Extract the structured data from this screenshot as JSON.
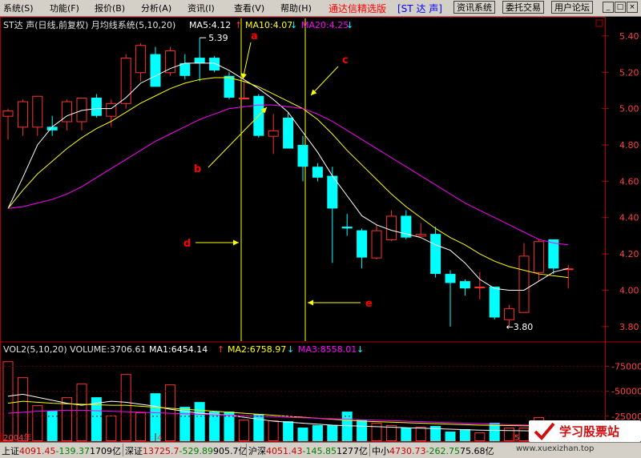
{
  "menu": {
    "items": [
      "系统(S)",
      "功能(F)",
      "报价(B)",
      "分析(A)",
      "资讯(I)",
      "查看(V)",
      "帮助(H)"
    ],
    "brand": "通达信精选版",
    "stock_tag": "[ST 达  声]",
    "buttons": [
      "资讯系统",
      "委托交易",
      "用户论坛"
    ],
    "window_controls": [
      "_",
      "□",
      "×"
    ]
  },
  "header": {
    "title": "ST达 声(日线,前复权) 月均线系统(5,10,20)",
    "ma5": "MA5:4.12",
    "ma10": "MA10:4.07",
    "ma20": "MA20:4.25"
  },
  "volume_header": {
    "title": "VOL2(5,10,20) VOLUME:3706.61",
    "ma1": "MA1:6454.14",
    "ma2": "MA2:6758.97",
    "ma3": "MA3:8558.01"
  },
  "annotations": {
    "a": "a",
    "b": "b",
    "c": "c",
    "d": "d",
    "e": "e",
    "high_label": "5.39",
    "low_label": "3.80"
  },
  "chart_data": {
    "type": "candlestick",
    "ylim": [
      3.72,
      5.47
    ],
    "yticks": [
      "5.40",
      "5.20",
      "5.00",
      "4.80",
      "4.60",
      "4.40",
      "4.20",
      "4.00",
      "3.80"
    ],
    "x_labels": [
      "2004年",
      "4",
      "5"
    ],
    "candles": [
      {
        "o": 4.96,
        "h": 5.0,
        "l": 4.83,
        "c": 4.99,
        "v": 10000
      },
      {
        "o": 4.9,
        "h": 5.05,
        "l": 4.85,
        "c": 5.04,
        "v": 8000
      },
      {
        "o": 4.9,
        "h": 5.07,
        "l": 4.85,
        "c": 5.07,
        "v": 4500
      },
      {
        "o": 4.9,
        "h": 4.96,
        "l": 4.85,
        "c": 4.88,
        "v": 3800
      },
      {
        "o": 4.93,
        "h": 5.05,
        "l": 4.88,
        "c": 5.04,
        "v": 5500
      },
      {
        "o": 4.93,
        "h": 5.06,
        "l": 4.88,
        "c": 5.06,
        "v": 7200
      },
      {
        "o": 5.06,
        "h": 5.08,
        "l": 4.95,
        "c": 4.96,
        "v": 5500
      },
      {
        "o": 4.96,
        "h": 5.05,
        "l": 4.9,
        "c": 5.03,
        "v": 3200
      },
      {
        "o": 5.03,
        "h": 5.3,
        "l": 5.0,
        "c": 5.28,
        "v": 8400
      },
      {
        "o": 5.2,
        "h": 5.36,
        "l": 5.15,
        "c": 5.35,
        "v": 3600
      },
      {
        "o": 5.3,
        "h": 5.34,
        "l": 5.12,
        "c": 5.12,
        "v": 6000
      },
      {
        "o": 5.2,
        "h": 5.34,
        "l": 5.18,
        "c": 5.32,
        "v": 7100
      },
      {
        "o": 5.25,
        "h": 5.3,
        "l": 5.16,
        "c": 5.18,
        "v": 4300
      },
      {
        "o": 5.28,
        "h": 5.39,
        "l": 5.15,
        "c": 5.25,
        "v": 4900
      },
      {
        "o": 5.28,
        "h": 5.29,
        "l": 5.2,
        "c": 5.21,
        "v": 3700
      },
      {
        "o": 5.18,
        "h": 5.2,
        "l": 5.05,
        "c": 5.06,
        "v": 3700
      },
      {
        "o": 5.06,
        "h": 5.15,
        "l": 5.06,
        "c": 5.06,
        "v": 2700
      },
      {
        "o": 5.07,
        "h": 5.08,
        "l": 4.84,
        "c": 4.85,
        "v": 3400
      },
      {
        "o": 4.85,
        "h": 4.97,
        "l": 4.75,
        "c": 4.88,
        "v": 2600
      },
      {
        "o": 4.95,
        "h": 4.98,
        "l": 4.78,
        "c": 4.78,
        "v": 2500
      },
      {
        "o": 4.8,
        "h": 4.85,
        "l": 4.6,
        "c": 4.68,
        "v": 1700
      },
      {
        "o": 4.68,
        "h": 4.7,
        "l": 4.6,
        "c": 4.62,
        "v": 2000
      },
      {
        "o": 4.63,
        "h": 4.68,
        "l": 4.15,
        "c": 4.45,
        "v": 2000
      },
      {
        "o": 4.35,
        "h": 4.42,
        "l": 4.3,
        "c": 4.34,
        "v": 3700
      },
      {
        "o": 4.33,
        "h": 4.34,
        "l": 4.12,
        "c": 4.18,
        "v": 2700
      },
      {
        "o": 4.18,
        "h": 4.36,
        "l": 4.17,
        "c": 4.33,
        "v": 2300
      },
      {
        "o": 4.28,
        "h": 4.44,
        "l": 4.27,
        "c": 4.41,
        "v": 2000
      },
      {
        "o": 4.41,
        "h": 4.44,
        "l": 4.28,
        "c": 4.29,
        "v": 1700
      },
      {
        "o": 4.3,
        "h": 4.37,
        "l": 4.3,
        "c": 4.31,
        "v": 1800
      },
      {
        "o": 4.31,
        "h": 4.35,
        "l": 4.07,
        "c": 4.09,
        "v": 1900
      },
      {
        "o": 4.09,
        "h": 4.11,
        "l": 3.8,
        "c": 4.04,
        "v": 1200
      },
      {
        "o": 4.05,
        "h": 4.06,
        "l": 3.97,
        "c": 4.01,
        "v": 1500
      },
      {
        "o": 4.02,
        "h": 4.1,
        "l": 3.95,
        "c": 4.02,
        "v": 1100
      },
      {
        "o": 4.02,
        "h": 4.02,
        "l": 3.84,
        "c": 3.85,
        "v": 2300
      },
      {
        "o": 3.84,
        "h": 3.92,
        "l": 3.8,
        "c": 3.9,
        "v": 1700
      },
      {
        "o": 3.88,
        "h": 4.26,
        "l": 3.88,
        "c": 4.19,
        "v": 1700
      },
      {
        "o": 4.1,
        "h": 4.28,
        "l": 4.05,
        "c": 4.27,
        "v": 3000
      },
      {
        "o": 4.28,
        "h": 4.28,
        "l": 4.09,
        "c": 4.12,
        "v": 1900
      },
      {
        "o": 4.12,
        "h": 4.14,
        "l": 4.01,
        "c": 4.12,
        "v": 1300
      }
    ],
    "ma5": [
      4.45,
      4.62,
      4.8,
      4.9,
      4.96,
      4.99,
      5.0,
      5.0,
      5.06,
      5.14,
      5.18,
      5.22,
      5.25,
      5.25,
      5.25,
      5.21,
      5.16,
      5.11,
      5.05,
      4.98,
      4.87,
      4.76,
      4.63,
      4.52,
      4.41,
      4.36,
      4.33,
      4.31,
      4.29,
      4.25,
      4.22,
      4.15,
      4.06,
      4.01,
      4.0,
      4.0,
      4.05,
      4.1,
      4.12
    ],
    "ma10": [
      4.45,
      4.55,
      4.64,
      4.71,
      4.78,
      4.84,
      4.89,
      4.93,
      4.98,
      5.03,
      5.07,
      5.11,
      5.14,
      5.16,
      5.17,
      5.17,
      5.15,
      5.12,
      5.08,
      5.04,
      5.0,
      4.94,
      4.86,
      4.77,
      4.69,
      4.61,
      4.53,
      4.46,
      4.4,
      4.34,
      4.29,
      4.25,
      4.2,
      4.16,
      4.13,
      4.11,
      4.09,
      4.08,
      4.07
    ],
    "ma20": [
      4.45,
      4.46,
      4.48,
      4.5,
      4.53,
      4.57,
      4.62,
      4.67,
      4.72,
      4.77,
      4.82,
      4.86,
      4.9,
      4.94,
      4.97,
      5.0,
      5.01,
      5.02,
      5.02,
      5.01,
      5.0,
      4.97,
      4.93,
      4.88,
      4.83,
      4.78,
      4.73,
      4.68,
      4.63,
      4.58,
      4.53,
      4.48,
      4.44,
      4.4,
      4.36,
      4.32,
      4.28,
      4.26,
      4.25
    ],
    "vol_ylim": [
      0,
      85000
    ],
    "vol_yticks": [
      "75000",
      "50000",
      "25000"
    ],
    "vol_ma1": [
      45000,
      47000,
      44000,
      41000,
      38000,
      36000,
      38000,
      40000,
      39000,
      37000,
      35000,
      32000,
      30000,
      28000,
      27000,
      26000,
      24000,
      22000,
      20000,
      19000,
      18000,
      17000,
      16000,
      15500,
      15000,
      14500,
      14000,
      13500,
      13000,
      12500,
      12000,
      11500,
      11000,
      10800,
      10600,
      10400,
      10200,
      10000,
      10000
    ],
    "vol_ma2": [
      38000,
      40000,
      39000,
      38000,
      37500,
      37000,
      36500,
      36000,
      36000,
      35000,
      34000,
      33000,
      32000,
      31000,
      30000,
      29000,
      28000,
      27000,
      26000,
      25000,
      24000,
      23000,
      22000,
      21000,
      20000,
      19500,
      19000,
      18500,
      18000,
      17500,
      17000,
      16500,
      16000,
      15800,
      15600,
      15400,
      15200,
      15000,
      14900
    ],
    "vol_ma3": [
      28000,
      29000,
      30000,
      30500,
      31000,
      31000,
      30500,
      30000,
      29500,
      29000,
      28500,
      28000,
      27500,
      27000,
      26500,
      26000,
      25500,
      25000,
      24500,
      24000,
      23500,
      23000,
      22500,
      22000,
      21500,
      21000,
      20500,
      20000,
      19500,
      19000,
      18500,
      18000,
      17500,
      17000,
      16500,
      16200,
      15900,
      15600,
      15300
    ]
  },
  "status": [
    {
      "label": "上证",
      "value": "4091.45",
      "change": "-139.37",
      "amount": "1709亿"
    },
    {
      "label": "深证",
      "value": "13725.7",
      "change": "-529.89",
      "amount": "905.7亿"
    },
    {
      "label": "沪深",
      "value": "4051.43",
      "change": "-145.85",
      "amount": "1277亿"
    },
    {
      "label": "中小",
      "value": "4730.73",
      "change": "-262.75",
      "amount": "75.68亿"
    }
  ],
  "watermark": {
    "text": "学习股票站",
    "url": "www.xuexizhan.top"
  },
  "colors": {
    "up": "#ff3030",
    "down": "#00ffff",
    "ma5": "#ffffff",
    "ma10": "#ffff00",
    "ma20": "#ff00ff",
    "guide": "#ffff00",
    "annotation": "#ff0000",
    "axis": "#b00000",
    "tick": "#ff4040"
  }
}
